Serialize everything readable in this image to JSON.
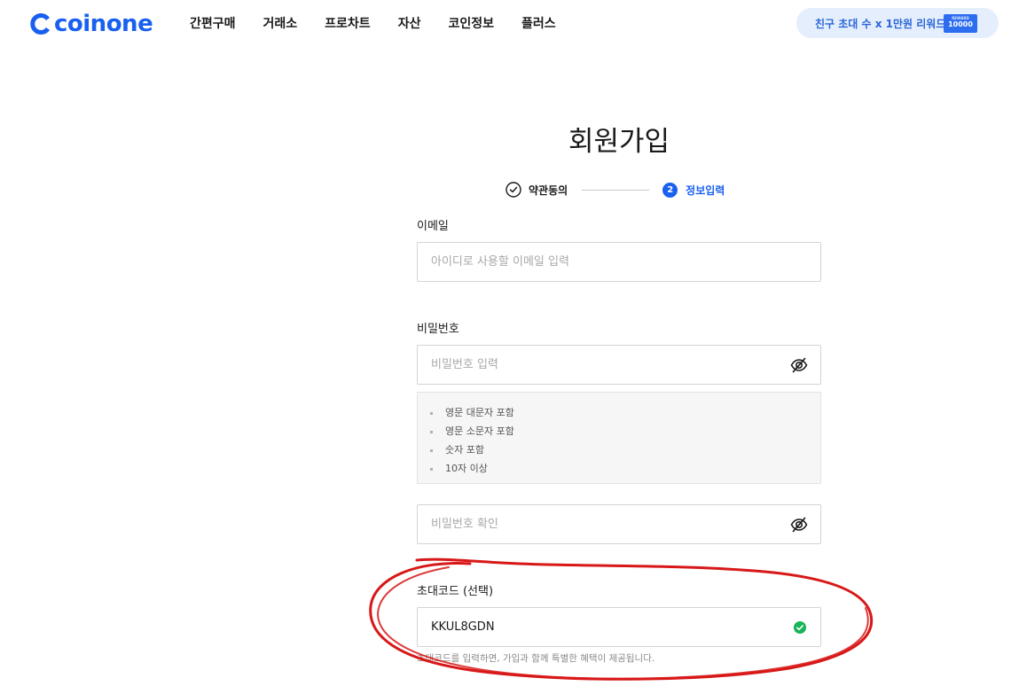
{
  "header": {
    "logo_text": "coinone",
    "nav": [
      "간편구매",
      "거래소",
      "프로차트",
      "자산",
      "코인정보",
      "플러스"
    ],
    "promo": {
      "text": "친구 초대 수 x 1만원 리워드",
      "badge_small": "REWARD",
      "badge_value": "10000"
    }
  },
  "page": {
    "title": "회원가입",
    "steps": [
      {
        "label": "약관동의",
        "state": "done",
        "icon": "check-circle-icon"
      },
      {
        "label": "정보입력",
        "state": "active",
        "number": "2"
      }
    ]
  },
  "form": {
    "email": {
      "label": "이메일",
      "placeholder": "아이디로 사용할 이메일 입력",
      "value": ""
    },
    "password": {
      "label": "비밀번호",
      "placeholder": "비밀번호 입력",
      "value": "",
      "toggle_icon": "eye-off-icon",
      "rules": [
        "영문 대문자 포함",
        "영문 소문자 포함",
        "숫자 포함",
        "10자 이상"
      ]
    },
    "password_confirm": {
      "placeholder": "비밀번호 확인",
      "value": "",
      "toggle_icon": "eye-off-icon"
    },
    "invite_code": {
      "label": "초대코드 (선택)",
      "value": "KKUL8GDN",
      "status_icon": "check-circle-green-icon",
      "hint": "초대코드를 입력하면, 가입과 함께 특별한 혜택이 제공됩니다."
    }
  },
  "colors": {
    "brand": "#1a60f0",
    "valid": "#19b35a",
    "annotation": "#d81818"
  }
}
